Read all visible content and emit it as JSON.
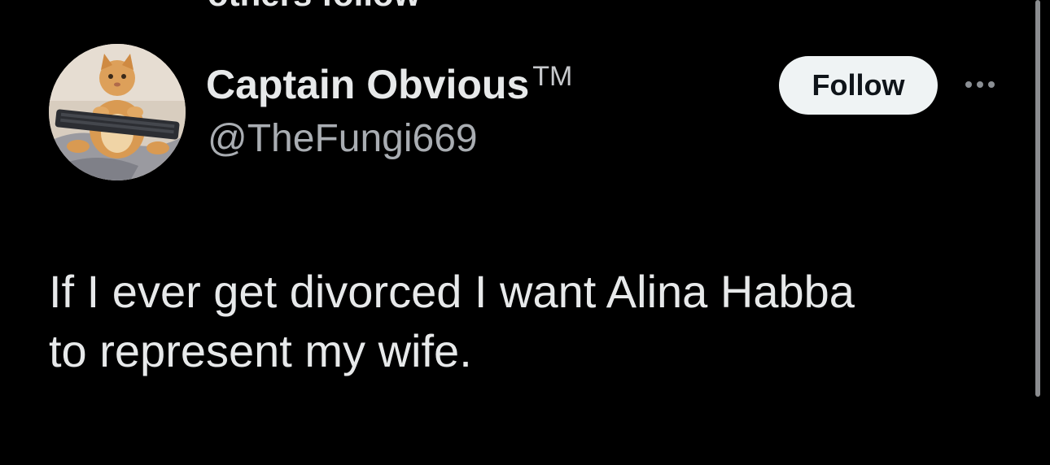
{
  "section_header": "others follow",
  "tweet": {
    "author": {
      "display_name": "Captain Obvious",
      "badge": "TM",
      "handle": "@TheFungi669",
      "avatar_icon": "cat-avatar"
    },
    "follow_label": "Follow",
    "more_icon": "more-dots-icon",
    "text": "If I ever get divorced I want Alina Habba\nto represent my wife."
  },
  "colors": {
    "background": "#000000",
    "primary_text": "#e7e9ea",
    "secondary_text": "#a9adb2",
    "button_bg": "#eff3f4",
    "button_text": "#0f1419"
  }
}
